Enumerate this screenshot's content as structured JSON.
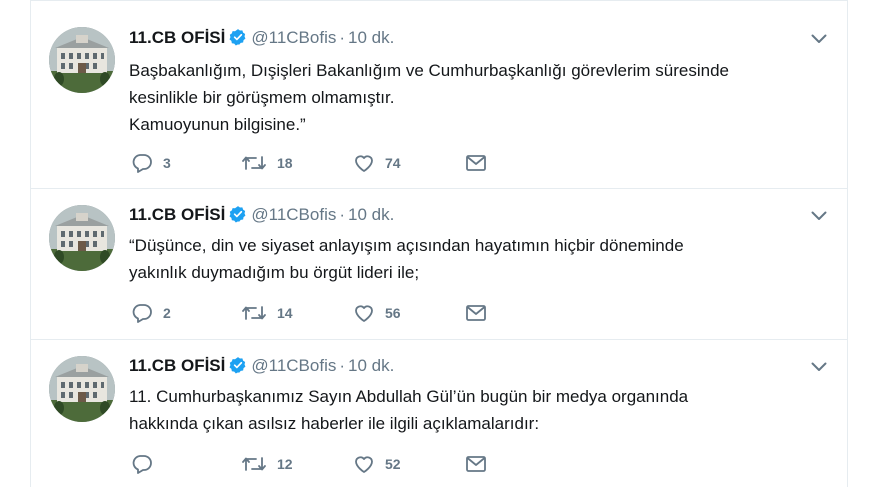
{
  "tweets": [
    {
      "author": {
        "name": "11.CB OFİSİ",
        "handle": "@11CBofis",
        "verified": true,
        "avatar_icon": "building-avatar-icon"
      },
      "separator": "·",
      "time": "10 dk.",
      "lines": [
        "Başbakanlığım, Dışişleri Bakanlığım ve Cumhurbaşkanlığı görevlerim süresinde",
        "kesinlikle bir görüşmem olmamıştır.",
        "Kamuoyunun bilgisine.”"
      ],
      "counts": {
        "replies": "3",
        "retweets": "18",
        "likes": "74"
      }
    },
    {
      "author": {
        "name": "11.CB OFİSİ",
        "handle": "@11CBofis",
        "verified": true,
        "avatar_icon": "building-avatar-icon"
      },
      "separator": "·",
      "time": "10 dk.",
      "lines": [
        "“Düşünce, din ve siyaset anlayışım açısından hayatımın hiçbir döneminde",
        "yakınlık duymadığım bu örgüt lideri ile;"
      ],
      "counts": {
        "replies": "2",
        "retweets": "14",
        "likes": "56"
      }
    },
    {
      "author": {
        "name": "11.CB OFİSİ",
        "handle": "@11CBofis",
        "verified": true,
        "avatar_icon": "building-avatar-icon"
      },
      "separator": "·",
      "time": "10 dk.",
      "lines": [
        "11. Cumhurbaşkanımız Sayın Abdullah Gül’ün bugün bir medya organında",
        "hakkında çıkan asılsız haberler ile ilgili açıklamalarıdır:"
      ],
      "counts": {
        "replies": "",
        "retweets": "12",
        "likes": "52"
      }
    }
  ],
  "colors": {
    "text": "#14171a",
    "secondary": "#657786",
    "verified": "#1da1f2",
    "border": "#e6ecf0"
  }
}
